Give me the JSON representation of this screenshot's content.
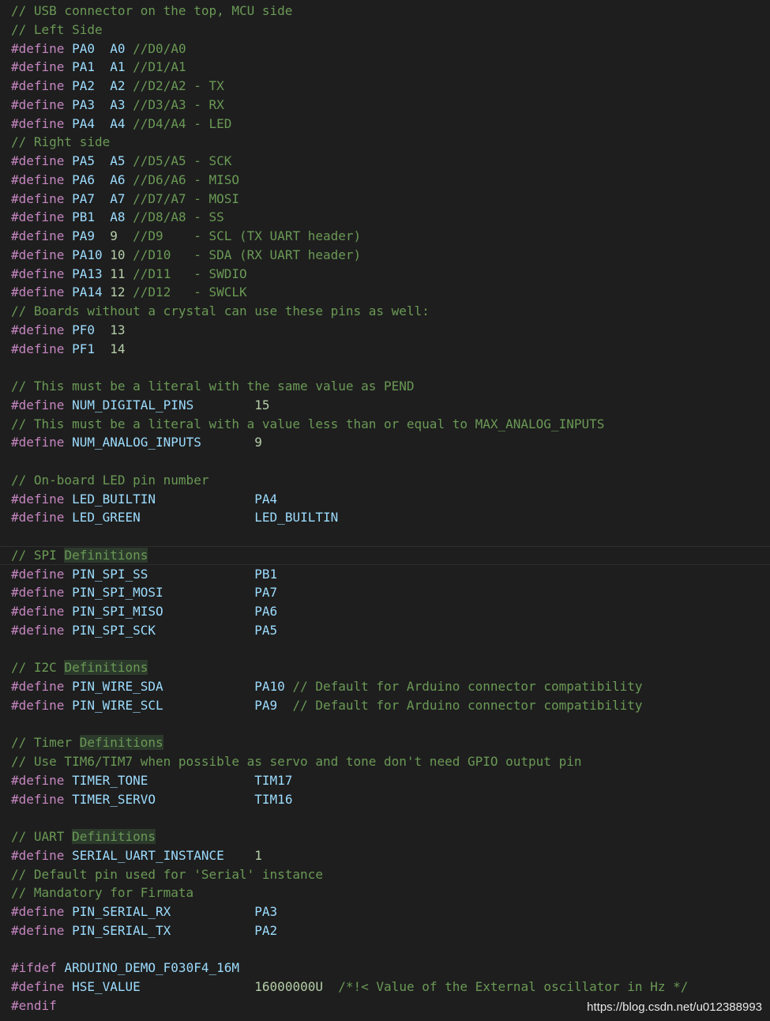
{
  "theme": {
    "background": "#1e1e1e",
    "comment": "#6a9955",
    "keyword": "#c586c0",
    "identifier": "#9cdcfe",
    "value": "#d4d4d4",
    "number": "#b5cea8",
    "macro": "#569cd6",
    "highlight": "#2c3a2c"
  },
  "watermark": "https://blog.csdn.net/u012388993",
  "lines": [
    [
      {
        "t": "comment",
        "v": "// USB connector on the top, MCU side"
      }
    ],
    [
      {
        "t": "comment",
        "v": "// Left Side"
      }
    ],
    [
      {
        "t": "keyword",
        "v": "#define"
      },
      {
        "t": "value",
        "v": " "
      },
      {
        "t": "ident",
        "v": "PA0"
      },
      {
        "t": "value",
        "v": "  "
      },
      {
        "t": "ident",
        "v": "A0"
      },
      {
        "t": "value",
        "v": " "
      },
      {
        "t": "comment",
        "v": "//D0/A0"
      }
    ],
    [
      {
        "t": "keyword",
        "v": "#define"
      },
      {
        "t": "value",
        "v": " "
      },
      {
        "t": "ident",
        "v": "PA1"
      },
      {
        "t": "value",
        "v": "  "
      },
      {
        "t": "ident",
        "v": "A1"
      },
      {
        "t": "value",
        "v": " "
      },
      {
        "t": "comment",
        "v": "//D1/A1"
      }
    ],
    [
      {
        "t": "keyword",
        "v": "#define"
      },
      {
        "t": "value",
        "v": " "
      },
      {
        "t": "ident",
        "v": "PA2"
      },
      {
        "t": "value",
        "v": "  "
      },
      {
        "t": "ident",
        "v": "A2"
      },
      {
        "t": "value",
        "v": " "
      },
      {
        "t": "comment",
        "v": "//D2/A2 - TX"
      }
    ],
    [
      {
        "t": "keyword",
        "v": "#define"
      },
      {
        "t": "value",
        "v": " "
      },
      {
        "t": "ident",
        "v": "PA3"
      },
      {
        "t": "value",
        "v": "  "
      },
      {
        "t": "ident",
        "v": "A3"
      },
      {
        "t": "value",
        "v": " "
      },
      {
        "t": "comment",
        "v": "//D3/A3 - RX"
      }
    ],
    [
      {
        "t": "keyword",
        "v": "#define"
      },
      {
        "t": "value",
        "v": " "
      },
      {
        "t": "ident",
        "v": "PA4"
      },
      {
        "t": "value",
        "v": "  "
      },
      {
        "t": "ident",
        "v": "A4"
      },
      {
        "t": "value",
        "v": " "
      },
      {
        "t": "comment",
        "v": "//D4/A4 - LED"
      }
    ],
    [
      {
        "t": "comment",
        "v": "// Right side"
      }
    ],
    [
      {
        "t": "keyword",
        "v": "#define"
      },
      {
        "t": "value",
        "v": " "
      },
      {
        "t": "ident",
        "v": "PA5"
      },
      {
        "t": "value",
        "v": "  "
      },
      {
        "t": "ident",
        "v": "A5"
      },
      {
        "t": "value",
        "v": " "
      },
      {
        "t": "comment",
        "v": "//D5/A5 - SCK"
      }
    ],
    [
      {
        "t": "keyword",
        "v": "#define"
      },
      {
        "t": "value",
        "v": " "
      },
      {
        "t": "ident",
        "v": "PA6"
      },
      {
        "t": "value",
        "v": "  "
      },
      {
        "t": "ident",
        "v": "A6"
      },
      {
        "t": "value",
        "v": " "
      },
      {
        "t": "comment",
        "v": "//D6/A6 - MISO"
      }
    ],
    [
      {
        "t": "keyword",
        "v": "#define"
      },
      {
        "t": "value",
        "v": " "
      },
      {
        "t": "ident",
        "v": "PA7"
      },
      {
        "t": "value",
        "v": "  "
      },
      {
        "t": "ident",
        "v": "A7"
      },
      {
        "t": "value",
        "v": " "
      },
      {
        "t": "comment",
        "v": "//D7/A7 - MOSI"
      }
    ],
    [
      {
        "t": "keyword",
        "v": "#define"
      },
      {
        "t": "value",
        "v": " "
      },
      {
        "t": "ident",
        "v": "PB1"
      },
      {
        "t": "value",
        "v": "  "
      },
      {
        "t": "ident",
        "v": "A8"
      },
      {
        "t": "value",
        "v": " "
      },
      {
        "t": "comment",
        "v": "//D8/A8 - SS"
      }
    ],
    [
      {
        "t": "keyword",
        "v": "#define"
      },
      {
        "t": "value",
        "v": " "
      },
      {
        "t": "ident",
        "v": "PA9"
      },
      {
        "t": "value",
        "v": "  "
      },
      {
        "t": "number",
        "v": "9"
      },
      {
        "t": "value",
        "v": "  "
      },
      {
        "t": "comment",
        "v": "//D9    - SCL (TX UART header)"
      }
    ],
    [
      {
        "t": "keyword",
        "v": "#define"
      },
      {
        "t": "value",
        "v": " "
      },
      {
        "t": "ident",
        "v": "PA10"
      },
      {
        "t": "value",
        "v": " "
      },
      {
        "t": "number",
        "v": "10"
      },
      {
        "t": "value",
        "v": " "
      },
      {
        "t": "comment",
        "v": "//D10   - SDA (RX UART header)"
      }
    ],
    [
      {
        "t": "keyword",
        "v": "#define"
      },
      {
        "t": "value",
        "v": " "
      },
      {
        "t": "ident",
        "v": "PA13"
      },
      {
        "t": "value",
        "v": " "
      },
      {
        "t": "number",
        "v": "11"
      },
      {
        "t": "value",
        "v": " "
      },
      {
        "t": "comment",
        "v": "//D11   - SWDIO"
      }
    ],
    [
      {
        "t": "keyword",
        "v": "#define"
      },
      {
        "t": "value",
        "v": " "
      },
      {
        "t": "ident",
        "v": "PA14"
      },
      {
        "t": "value",
        "v": " "
      },
      {
        "t": "number",
        "v": "12"
      },
      {
        "t": "value",
        "v": " "
      },
      {
        "t": "comment",
        "v": "//D12   - SWCLK"
      }
    ],
    [
      {
        "t": "comment",
        "v": "// Boards without a crystal can use these pins as well:"
      }
    ],
    [
      {
        "t": "keyword",
        "v": "#define"
      },
      {
        "t": "value",
        "v": " "
      },
      {
        "t": "ident",
        "v": "PF0"
      },
      {
        "t": "value",
        "v": "  "
      },
      {
        "t": "number",
        "v": "13"
      }
    ],
    [
      {
        "t": "keyword",
        "v": "#define"
      },
      {
        "t": "value",
        "v": " "
      },
      {
        "t": "ident",
        "v": "PF1"
      },
      {
        "t": "value",
        "v": "  "
      },
      {
        "t": "number",
        "v": "14"
      }
    ],
    [],
    [
      {
        "t": "comment",
        "v": "// This must be a literal with the same value as PEND"
      }
    ],
    [
      {
        "t": "keyword",
        "v": "#define"
      },
      {
        "t": "value",
        "v": " "
      },
      {
        "t": "ident",
        "v": "NUM_DIGITAL_PINS"
      },
      {
        "t": "value",
        "v": "        "
      },
      {
        "t": "number",
        "v": "15"
      }
    ],
    [
      {
        "t": "comment",
        "v": "// This must be a literal with a value less than or equal to MAX_ANALOG_INPUTS"
      }
    ],
    [
      {
        "t": "keyword",
        "v": "#define"
      },
      {
        "t": "value",
        "v": " "
      },
      {
        "t": "ident",
        "v": "NUM_ANALOG_INPUTS"
      },
      {
        "t": "value",
        "v": "       "
      },
      {
        "t": "number",
        "v": "9"
      }
    ],
    [],
    [
      {
        "t": "comment",
        "v": "// On-board LED pin number"
      }
    ],
    [
      {
        "t": "keyword",
        "v": "#define"
      },
      {
        "t": "value",
        "v": " "
      },
      {
        "t": "ident",
        "v": "LED_BUILTIN"
      },
      {
        "t": "value",
        "v": "             "
      },
      {
        "t": "ident",
        "v": "PA4"
      }
    ],
    [
      {
        "t": "keyword",
        "v": "#define"
      },
      {
        "t": "value",
        "v": " "
      },
      {
        "t": "ident",
        "v": "LED_GREEN"
      },
      {
        "t": "value",
        "v": "               "
      },
      {
        "t": "ident",
        "v": "LED_BUILTIN"
      }
    ],
    [],
    {
      "hl": true,
      "tokens": [
        {
          "t": "comment",
          "v": "// SPI "
        },
        {
          "t": "hlword",
          "v": "Definitions"
        }
      ]
    },
    [
      {
        "t": "keyword",
        "v": "#define"
      },
      {
        "t": "value",
        "v": " "
      },
      {
        "t": "ident",
        "v": "PIN_SPI_SS"
      },
      {
        "t": "value",
        "v": "              "
      },
      {
        "t": "ident",
        "v": "PB1"
      }
    ],
    [
      {
        "t": "keyword",
        "v": "#define"
      },
      {
        "t": "value",
        "v": " "
      },
      {
        "t": "ident",
        "v": "PIN_SPI_MOSI"
      },
      {
        "t": "value",
        "v": "            "
      },
      {
        "t": "ident",
        "v": "PA7"
      }
    ],
    [
      {
        "t": "keyword",
        "v": "#define"
      },
      {
        "t": "value",
        "v": " "
      },
      {
        "t": "ident",
        "v": "PIN_SPI_MISO"
      },
      {
        "t": "value",
        "v": "            "
      },
      {
        "t": "ident",
        "v": "PA6"
      }
    ],
    [
      {
        "t": "keyword",
        "v": "#define"
      },
      {
        "t": "value",
        "v": " "
      },
      {
        "t": "ident",
        "v": "PIN_SPI_SCK"
      },
      {
        "t": "value",
        "v": "             "
      },
      {
        "t": "ident",
        "v": "PA5"
      }
    ],
    [],
    [
      {
        "t": "comment",
        "v": "// I2C "
      },
      {
        "t": "hlword",
        "v": "Definitions"
      }
    ],
    [
      {
        "t": "keyword",
        "v": "#define"
      },
      {
        "t": "value",
        "v": " "
      },
      {
        "t": "ident",
        "v": "PIN_WIRE_SDA"
      },
      {
        "t": "value",
        "v": "            "
      },
      {
        "t": "ident",
        "v": "PA10"
      },
      {
        "t": "value",
        "v": " "
      },
      {
        "t": "comment",
        "v": "// Default for Arduino connector compatibility"
      }
    ],
    [
      {
        "t": "keyword",
        "v": "#define"
      },
      {
        "t": "value",
        "v": " "
      },
      {
        "t": "ident",
        "v": "PIN_WIRE_SCL"
      },
      {
        "t": "value",
        "v": "            "
      },
      {
        "t": "ident",
        "v": "PA9"
      },
      {
        "t": "value",
        "v": "  "
      },
      {
        "t": "comment",
        "v": "// Default for Arduino connector compatibility"
      }
    ],
    [],
    [
      {
        "t": "comment",
        "v": "// Timer "
      },
      {
        "t": "hlword",
        "v": "Definitions"
      }
    ],
    [
      {
        "t": "comment",
        "v": "// Use TIM6/TIM7 when possible as servo and tone don't need GPIO output pin"
      }
    ],
    [
      {
        "t": "keyword",
        "v": "#define"
      },
      {
        "t": "value",
        "v": " "
      },
      {
        "t": "ident",
        "v": "TIMER_TONE"
      },
      {
        "t": "value",
        "v": "              "
      },
      {
        "t": "ident",
        "v": "TIM17"
      }
    ],
    [
      {
        "t": "keyword",
        "v": "#define"
      },
      {
        "t": "value",
        "v": " "
      },
      {
        "t": "ident",
        "v": "TIMER_SERVO"
      },
      {
        "t": "value",
        "v": "             "
      },
      {
        "t": "ident",
        "v": "TIM16"
      }
    ],
    [],
    [
      {
        "t": "comment",
        "v": "// UART "
      },
      {
        "t": "hlword",
        "v": "Definitions"
      }
    ],
    [
      {
        "t": "keyword",
        "v": "#define"
      },
      {
        "t": "value",
        "v": " "
      },
      {
        "t": "ident",
        "v": "SERIAL_UART_INSTANCE"
      },
      {
        "t": "value",
        "v": "    "
      },
      {
        "t": "number",
        "v": "1"
      }
    ],
    [
      {
        "t": "comment",
        "v": "// Default pin used for 'Serial' instance"
      }
    ],
    [
      {
        "t": "comment",
        "v": "// Mandatory for Firmata"
      }
    ],
    [
      {
        "t": "keyword",
        "v": "#define"
      },
      {
        "t": "value",
        "v": " "
      },
      {
        "t": "ident",
        "v": "PIN_SERIAL_RX"
      },
      {
        "t": "value",
        "v": "           "
      },
      {
        "t": "ident",
        "v": "PA3"
      }
    ],
    [
      {
        "t": "keyword",
        "v": "#define"
      },
      {
        "t": "value",
        "v": " "
      },
      {
        "t": "ident",
        "v": "PIN_SERIAL_TX"
      },
      {
        "t": "value",
        "v": "           "
      },
      {
        "t": "ident",
        "v": "PA2"
      }
    ],
    [],
    [
      {
        "t": "keyword",
        "v": "#ifdef"
      },
      {
        "t": "value",
        "v": " "
      },
      {
        "t": "ident",
        "v": "ARDUINO_DEMO_F030F4_16M"
      }
    ],
    [
      {
        "t": "keyword",
        "v": "#define"
      },
      {
        "t": "value",
        "v": " "
      },
      {
        "t": "ident",
        "v": "HSE_VALUE"
      },
      {
        "t": "value",
        "v": "               "
      },
      {
        "t": "number",
        "v": "16000000U"
      },
      {
        "t": "value",
        "v": "  "
      },
      {
        "t": "comment",
        "v": "/*!< Value of the External oscillator in Hz */"
      }
    ],
    [
      {
        "t": "keyword",
        "v": "#endif"
      }
    ]
  ]
}
